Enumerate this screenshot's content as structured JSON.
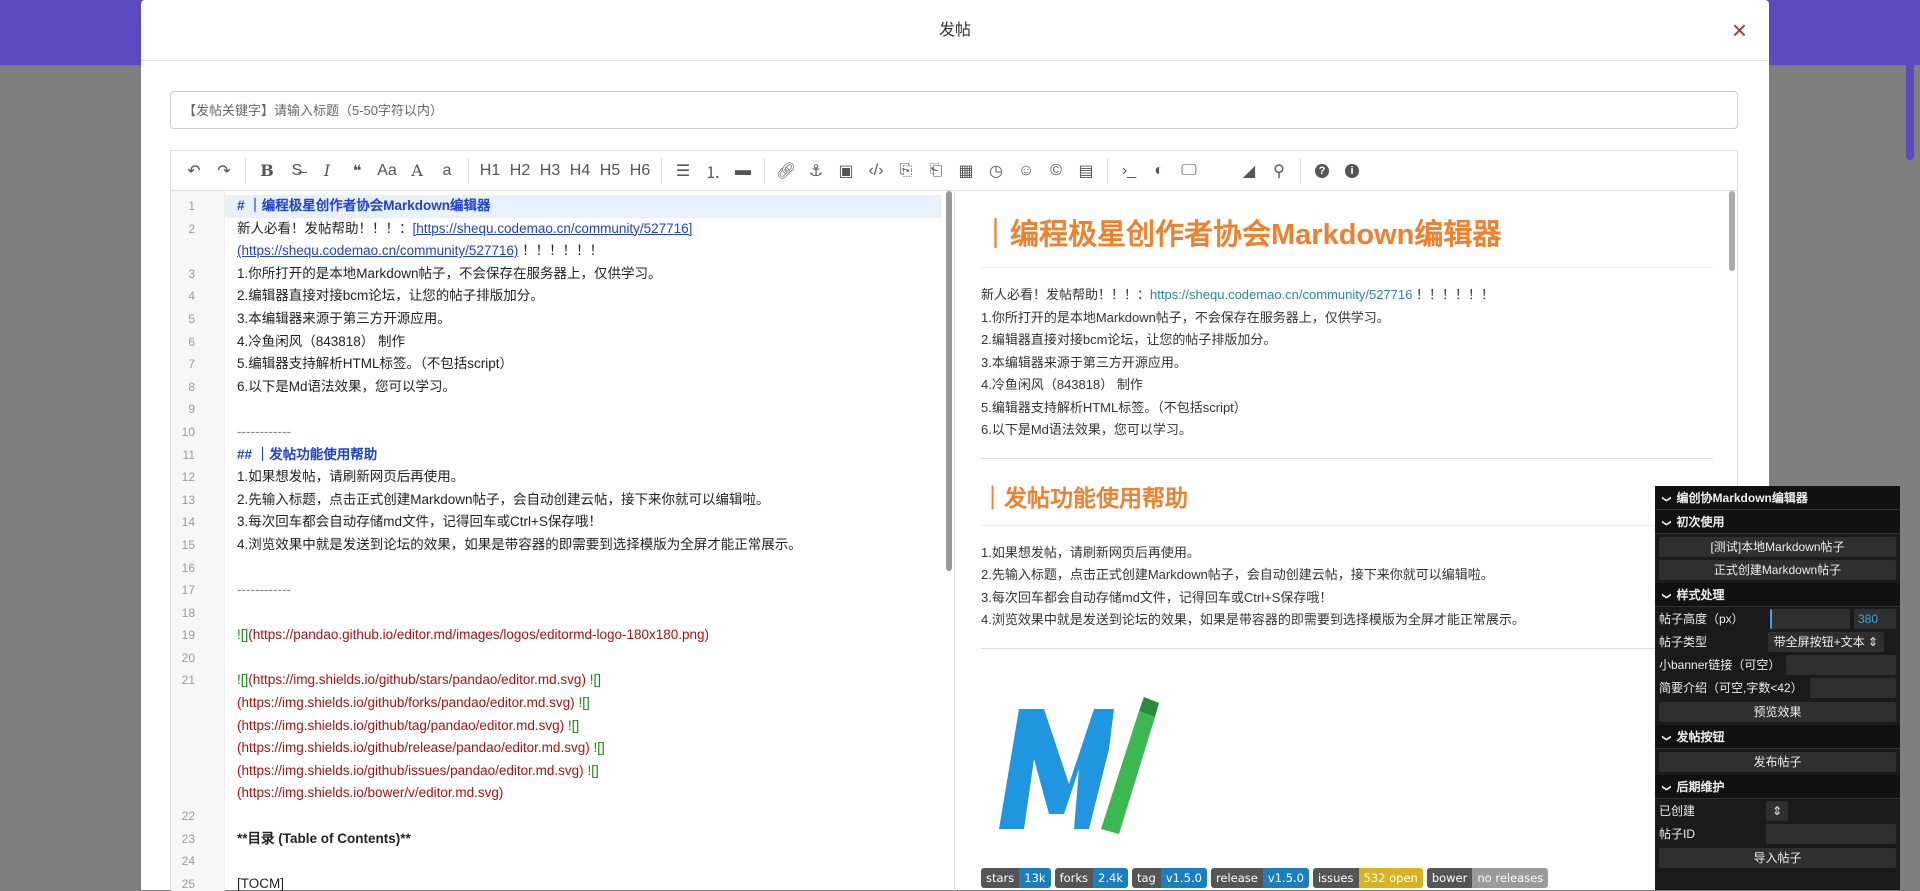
{
  "modal": {
    "title": "发帖",
    "close": "×"
  },
  "title_input": {
    "placeholder": "【发帖关键字】请输入标题（5-50字符以内）",
    "value": ""
  },
  "toolbar": [
    {
      "icon": "undo-icon"
    },
    {
      "icon": "redo-icon"
    },
    {
      "sep": true
    },
    {
      "icon": "bold-icon"
    },
    {
      "icon": "strikethrough-icon"
    },
    {
      "icon": "italic-icon"
    },
    {
      "icon": "quote-icon"
    },
    {
      "icon": "uppercase-icon"
    },
    {
      "icon": "uppercase-a-icon"
    },
    {
      "icon": "lowercase-icon"
    },
    {
      "sep": true
    },
    {
      "label": "H1"
    },
    {
      "label": "H2"
    },
    {
      "label": "H3"
    },
    {
      "label": "H4"
    },
    {
      "label": "H5"
    },
    {
      "label": "H6"
    },
    {
      "sep": true
    },
    {
      "icon": "unordered-list-icon"
    },
    {
      "icon": "ordered-list-icon"
    },
    {
      "icon": "horizontal-rule-icon"
    },
    {
      "sep": true
    },
    {
      "icon": "link-icon"
    },
    {
      "icon": "anchor-icon"
    },
    {
      "icon": "image-icon"
    },
    {
      "icon": "code-icon"
    },
    {
      "icon": "code-block-icon"
    },
    {
      "icon": "code-file-icon"
    },
    {
      "icon": "table-icon"
    },
    {
      "icon": "datetime-icon"
    },
    {
      "icon": "emoji-icon"
    },
    {
      "icon": "html-entities-icon"
    },
    {
      "icon": "pagebreak-icon"
    },
    {
      "sep": true
    },
    {
      "icon": "terminal-icon"
    },
    {
      "icon": "preview-toggle-icon"
    },
    {
      "icon": "fullscreen-icon"
    },
    {
      "icon": "spacer"
    },
    {
      "icon": "eraser-icon"
    },
    {
      "icon": "search-icon"
    },
    {
      "sep": true
    },
    {
      "icon": "help-icon"
    },
    {
      "icon": "info-icon"
    }
  ],
  "editor_lines": [
    {
      "n": "1",
      "fold": true,
      "active": true,
      "parts": [
        [
          "h",
          "# ｜编程极星创作者协会Markdown编辑器"
        ]
      ]
    },
    {
      "n": "2",
      "parts": [
        [
          "",
          "新人必看！发帖帮助！！！："
        ],
        [
          "lk",
          "[https://shequ.codemao.cn/community/527716]"
        ]
      ]
    },
    {
      "n": "",
      "parts": [
        [
          "lk",
          "(https://shequ.codemao.cn/community/527716)"
        ],
        [
          "",
          " ！！！！！！"
        ]
      ]
    },
    {
      "n": "3",
      "parts": [
        [
          "",
          "1.你所打开的是本地Markdown帖子，不会保存在服务器上，仅供学习。"
        ]
      ]
    },
    {
      "n": "4",
      "parts": [
        [
          "",
          "2.编辑器直接对接bcm论坛，让您的帖子排版加分。"
        ]
      ]
    },
    {
      "n": "5",
      "parts": [
        [
          "",
          "3.本编辑器来源于第三方开源应用。"
        ]
      ]
    },
    {
      "n": "6",
      "parts": [
        [
          "",
          "4.冷鱼闲风（843818） 制作"
        ]
      ]
    },
    {
      "n": "7",
      "parts": [
        [
          "",
          "5.编辑器支持解析HTML标签。（不包括script）"
        ]
      ]
    },
    {
      "n": "8",
      "parts": [
        [
          "",
          "6.以下是Md语法效果，您可以学习。"
        ]
      ]
    },
    {
      "n": "9",
      "parts": []
    },
    {
      "n": "10",
      "parts": [
        [
          "gray",
          "------------"
        ]
      ]
    },
    {
      "n": "11",
      "fold": true,
      "parts": [
        [
          "h",
          "## ｜发帖功能使用帮助"
        ]
      ]
    },
    {
      "n": "12",
      "parts": [
        [
          "",
          "1.如果想发帖，请刷新网页后再使用。"
        ]
      ]
    },
    {
      "n": "13",
      "parts": [
        [
          "",
          "2.先输入标题，点击正式创建Markdown帖子，会自动创建云帖，接下来你就可以编辑啦。"
        ]
      ]
    },
    {
      "n": "14",
      "parts": [
        [
          "",
          "3.每次回车都会自动存储md文件，记得回车或Ctrl+S保存哦！"
        ]
      ]
    },
    {
      "n": "15",
      "parts": [
        [
          "",
          "4.浏览效果中就是发送到论坛的效果，如果是带容器的即需要到选择模版为全屏才能正常展示。"
        ]
      ]
    },
    {
      "n": "16",
      "parts": []
    },
    {
      "n": "17",
      "parts": [
        [
          "gray",
          "------------"
        ]
      ]
    },
    {
      "n": "18",
      "parts": []
    },
    {
      "n": "19",
      "parts": [
        [
          "grn",
          "![]"
        ],
        [
          "red",
          "(https://pandao.github.io/editor.md/images/logos/editormd-logo-180x180.png)"
        ]
      ]
    },
    {
      "n": "20",
      "parts": []
    },
    {
      "n": "21",
      "parts": [
        [
          "grn",
          "![]"
        ],
        [
          "red",
          "(https://img.shields.io/github/stars/pandao/editor.md.svg) "
        ],
        [
          "grn",
          "![]"
        ]
      ]
    },
    {
      "n": "",
      "parts": [
        [
          "red",
          "(https://img.shields.io/github/forks/pandao/editor.md.svg) "
        ],
        [
          "grn",
          "![]"
        ]
      ]
    },
    {
      "n": "",
      "parts": [
        [
          "red",
          "(https://img.shields.io/github/tag/pandao/editor.md.svg) "
        ],
        [
          "grn",
          "![]"
        ]
      ]
    },
    {
      "n": "",
      "parts": [
        [
          "red",
          "(https://img.shields.io/github/release/pandao/editor.md.svg) "
        ],
        [
          "grn",
          "![]"
        ]
      ]
    },
    {
      "n": "",
      "parts": [
        [
          "red",
          "(https://img.shields.io/github/issues/pandao/editor.md.svg) "
        ],
        [
          "grn",
          "![]"
        ]
      ]
    },
    {
      "n": "",
      "parts": [
        [
          "red",
          "(https://img.shields.io/bower/v/editor.md.svg)"
        ]
      ]
    },
    {
      "n": "22",
      "parts": []
    },
    {
      "n": "23",
      "parts": [
        [
          "b",
          "**目录 (Table of Contents)**"
        ]
      ]
    },
    {
      "n": "24",
      "parts": []
    },
    {
      "n": "25",
      "parts": [
        [
          "",
          "[TOCM]"
        ]
      ]
    }
  ],
  "preview": {
    "h1": "｜编程极星创作者协会Markdown编辑器",
    "intro_prefix": "新人必看！发帖帮助！！！：",
    "intro_link": "https://shequ.codemao.cn/community/527716",
    "intro_suffix": " ！！！！！！",
    "list1": [
      "1.你所打开的是本地Markdown帖子，不会保存在服务器上，仅供学习。",
      "2.编辑器直接对接bcm论坛，让您的帖子排版加分。",
      "3.本编辑器来源于第三方开源应用。",
      "4.冷鱼闲风（843818） 制作",
      "5.编辑器支持解析HTML标签。（不包括script）",
      "6.以下是Md语法效果，您可以学习。"
    ],
    "h2": "｜发帖功能使用帮助",
    "list2": [
      "1.如果想发帖，请刷新网页后再使用。",
      "2.先输入标题，点击正式创建Markdown帖子，会自动创建云帖，接下来你就可以编辑啦。",
      "3.每次回车都会自动存储md文件，记得回车或Ctrl+S保存哦！",
      "4.浏览效果中就是发送到论坛的效果，如果是带容器的即需要到选择模版为全屏才能正常展示。"
    ],
    "badges": [
      {
        "k": "stars",
        "v": "13k",
        "color": "#1a7ec1"
      },
      {
        "k": "forks",
        "v": "2.4k",
        "color": "#1a7ec1"
      },
      {
        "k": "tag",
        "v": "v1.5.0",
        "color": "#1a7ec1"
      },
      {
        "k": "release",
        "v": "v1.5.0",
        "color": "#1a7ec1"
      },
      {
        "k": "issues",
        "v": "532 open",
        "color": "#d9b21f"
      },
      {
        "k": "bower",
        "v": "no releases",
        "color": "#9a9a9a"
      }
    ]
  },
  "panel": {
    "title": "编创协Markdown编辑器",
    "sec1": "初次使用",
    "btn_test": "[测试]本地Markdown帖子",
    "btn_create": "正式创建Markdown帖子",
    "sec2": "样式处理",
    "height_label": "帖子高度（px）",
    "height_value": "380",
    "type_label": "帖子类型",
    "type_value": "带全屏按钮+文本 ⇕",
    "banner_label": "小banner链接（可空）",
    "intro_label": "简要介绍（可空,字数<42）",
    "btn_preview": "预览效果",
    "sec3": "发帖按钮",
    "btn_publish": "发布帖子",
    "sec4": "后期维护",
    "created_label": "已创建",
    "created_value": "⇕",
    "id_label": "帖子ID",
    "btn_import": "导入帖子"
  }
}
